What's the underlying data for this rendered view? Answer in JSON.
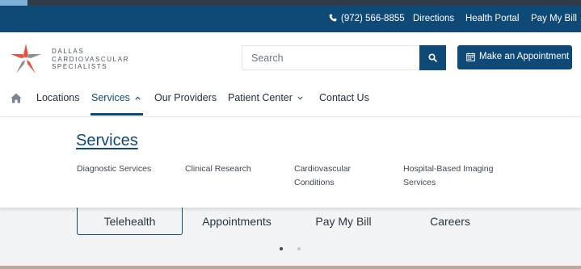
{
  "utility_bar": {
    "phone": "(972) 566-8855",
    "directions": "Directions",
    "health_portal": "Health Portal",
    "pay_my_bill": "Pay My Bill",
    "phone_icon": "phone-icon"
  },
  "header": {
    "logo_lines": [
      "DALLAS",
      "CARDIOVASCULAR",
      "SPECIALISTS"
    ],
    "search_placeholder": "Search",
    "search_icon": "search-icon",
    "appointment_label": "Make an Appointment",
    "appointment_icon": "calendar-icon"
  },
  "nav": {
    "home_icon": "home-icon",
    "items": [
      {
        "label": "Locations"
      },
      {
        "label": "Services"
      },
      {
        "label": "Our Providers"
      },
      {
        "label": "Patient Center"
      },
      {
        "label": "Contact Us"
      }
    ],
    "active": "Services"
  },
  "dropdown": {
    "title": "Services",
    "links": [
      {
        "line1": "Diagnostic Services",
        "line2": ""
      },
      {
        "line1": "Clinical Research",
        "line2": ""
      },
      {
        "line1": "Cardiovascular",
        "line2": "Conditions"
      },
      {
        "line1": "Hospital-Based Imaging",
        "line2": "Services"
      }
    ]
  },
  "quick_links": [
    {
      "label": "Telehealth"
    },
    {
      "label": "Appointments"
    },
    {
      "label": "Pay My Bill"
    },
    {
      "label": "Careers"
    }
  ],
  "carousel": {
    "active_dot": 0,
    "dot_count": 2
  },
  "colors": {
    "brand_blue": "#0f4a77",
    "logo_red": "#e8513a",
    "logo_gray": "#8a9097",
    "accent_light_blue": "#7fb1d6"
  }
}
